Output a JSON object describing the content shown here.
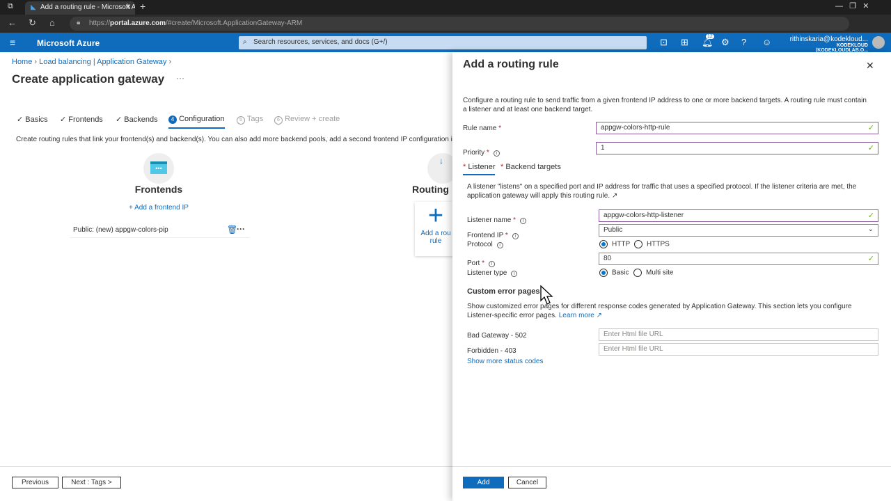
{
  "browser": {
    "tab_title": "Add a routing rule - Microsoft A",
    "url_prefix": "https://",
    "url_host": "portal.azure.com",
    "url_path": "/#create/Microsoft.ApplicationGateway-ARM"
  },
  "header": {
    "brand": "Microsoft Azure",
    "search_placeholder": "Search resources, services, and docs (G+/)",
    "notifications_count": "12",
    "user_email": "rithinskaria@kodekloud...",
    "user_tenant": "KODEKLOUD (KODEKLOUDLAB.O..."
  },
  "breadcrumb": [
    "Home",
    "Load balancing | Application Gateway"
  ],
  "page_title": "Create application gateway",
  "steps": [
    {
      "label": "Basics",
      "state": "done"
    },
    {
      "label": "Frontends",
      "state": "done"
    },
    {
      "label": "Backends",
      "state": "done"
    },
    {
      "num": "4",
      "label": "Configuration",
      "state": "active"
    },
    {
      "num": "5",
      "label": "Tags",
      "state": "disabled"
    },
    {
      "num": "6",
      "label": "Review + create",
      "state": "disabled"
    }
  ],
  "config_desc": "Create routing rules that link your frontend(s) and backend(s). You can also add more backend pools, add a second frontend IP configuration if you ha",
  "frontends": {
    "title": "Frontends",
    "add": "+ Add a frontend IP",
    "item": "Public: (new) appgw-colors-pip"
  },
  "routing": {
    "title": "Routing",
    "add_line1": "Add a rou",
    "add_line2": "rule"
  },
  "footer": {
    "previous": "Previous",
    "next": "Next : Tags >"
  },
  "panel": {
    "title": "Add a routing rule",
    "desc": "Configure a routing rule to send traffic from a given frontend IP address to one or more backend targets. A routing rule must contain a listener and at least one backend target.",
    "rule_name_label": "Rule name",
    "rule_name_value": "appgw-colors-http-rule",
    "priority_label": "Priority",
    "priority_value": "1",
    "tabs": [
      "Listener",
      "Backend targets"
    ],
    "listener_desc": "A listener \"listens\" on a specified port and IP address for traffic that uses a specified protocol. If the listener criteria are met, the application gateway will apply this routing rule.",
    "listener_name_label": "Listener name",
    "listener_name_value": "appgw-colors-http-listener",
    "frontend_ip_label": "Frontend IP",
    "frontend_ip_value": "Public",
    "protocol_label": "Protocol",
    "protocol_options": [
      "HTTP",
      "HTTPS"
    ],
    "protocol_selected": "HTTP",
    "port_label": "Port",
    "port_value": "80",
    "listener_type_label": "Listener type",
    "listener_type_options": [
      "Basic",
      "Multi site"
    ],
    "listener_type_selected": "Basic",
    "custom_error_title": "Custom error pages",
    "custom_error_desc": "Show customized error pages for different response codes generated by Application Gateway. This section lets you configure Listener-specific error pages.",
    "learn_more": "Learn more",
    "bad_gateway_label": "Bad Gateway - 502",
    "forbidden_label": "Forbidden - 403",
    "url_placeholder": "Enter Html file URL",
    "show_more": "Show more status codes",
    "add": "Add",
    "cancel": "Cancel"
  }
}
